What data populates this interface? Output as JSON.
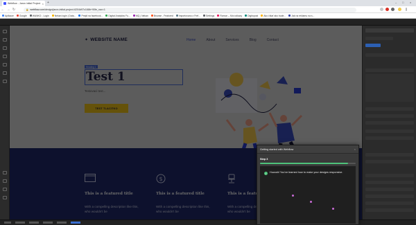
{
  "browser": {
    "tab_title": "Webflow - Jaron initial Project",
    "tab_close": "×",
    "new_tab": "+",
    "window_controls": {
      "minimize": "–",
      "maximize": "□",
      "close": "×"
    },
    "back": "←",
    "forward": "→",
    "reload": "↻",
    "url_host": "webflow.com",
    "url_path": "/design/jaron-initial-project-6204d97c168b+90fe_nav=1"
  },
  "bookmarks": [
    {
      "label": "Aplikace",
      "color": "#4285f4"
    },
    {
      "label": "Google",
      "color": "#ea4335"
    },
    {
      "label": "WANKO - Login",
      "color": "#5f6368"
    },
    {
      "label": "Nekan login | Data...",
      "color": "#f4b400"
    },
    {
      "label": "Prejdi na facebook...",
      "color": "#1877f2"
    },
    {
      "label": "Digital Analytics Fu...",
      "color": "#34a853"
    },
    {
      "label": "MQ | Nekan",
      "color": "#9c27b0"
    },
    {
      "label": "Browse - Featured",
      "color": "#ff5722"
    },
    {
      "label": "Importovano z Fref...",
      "color": "#607d8b"
    },
    {
      "label": "Settings",
      "color": "#5f6368"
    },
    {
      "label": "Romon – Moi odkazy",
      "color": "#e91e63"
    },
    {
      "label": "Digitopost",
      "color": "#00897b"
    },
    {
      "label": "Ako číšať ako bude...",
      "color": "#ffb300"
    },
    {
      "label": "Jak na reklamu na s...",
      "color": "#3949ab"
    }
  ],
  "site": {
    "logo_star": "✦",
    "logo": "WEBSITE NAME",
    "nav": [
      "Home",
      "About",
      "Services",
      "Blog",
      "Contact"
    ],
    "selected_label": "Heading 1",
    "hero_heading": "Test 1",
    "hero_sub": "Testovaci text...",
    "hero_button": "TEST TLACITKO",
    "features": [
      {
        "title": "This is a featured title",
        "desc": "With a compelling description like this, who wouldn't be"
      },
      {
        "title": "This is a featured title",
        "desc": "With a compelling description like this, who wouldn't be"
      },
      {
        "title": "This is a featured title",
        "desc": "With a compelling description like this, who wouldn't be"
      }
    ]
  },
  "popup": {
    "title": "Getting started with Webflow",
    "close": "×",
    "step": "Step 3",
    "progress": 0.92,
    "message": "Huzzah! You've learned how to make your designs responsive.",
    "check": "✓"
  },
  "colors": {
    "accent": "#4353ff",
    "button_yellow": "#f0c419",
    "feature_bg": "#1f2a6b",
    "success": "#4ec37a"
  }
}
